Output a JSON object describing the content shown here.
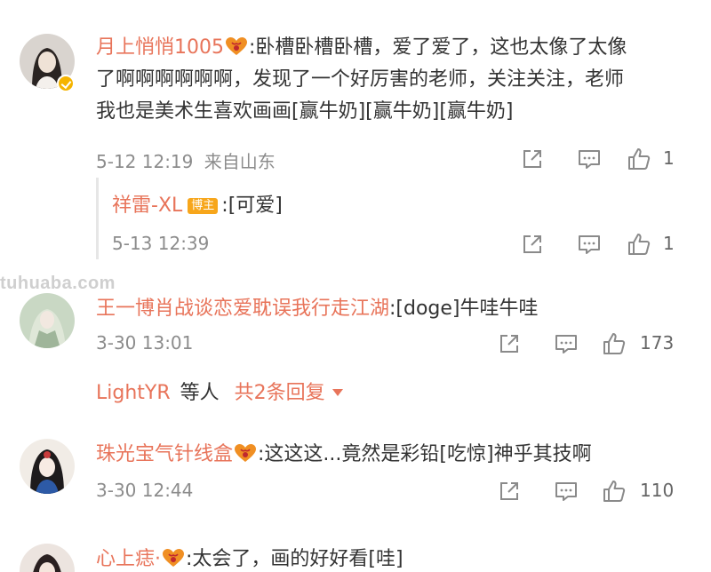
{
  "comments": [
    {
      "username": "月上悄悄1005",
      "text_line1": ":卧槽卧槽卧槽，爱了爱了，这也太像了太像",
      "text_line2": "了啊啊啊啊啊啊，发现了一个好厉害的老师，关注关注，老师",
      "text_line3": "我也是美术生喜欢画画[赢牛奶][赢牛奶][赢牛奶]",
      "time": "5-12 12:19",
      "location": "来自山东",
      "likes": "1"
    },
    {
      "username": "王一博肖战谈恋爱耽误我行走江湖",
      "text": ":[doge]牛哇牛哇",
      "time": "3-30 13:01",
      "likes": "173"
    },
    {
      "username": "珠光宝气针线盒",
      "text": ":这这这...竟然是彩铅[吃惊]神乎其技啊",
      "time": "3-30 12:44",
      "likes": "110"
    },
    {
      "username": "心上痣·",
      "text": ":太会了，画的好好看[哇]"
    }
  ],
  "reply": {
    "username": "祥雷-XL",
    "badge": "博主",
    "text": ":[可爱]",
    "time": "5-13 12:39",
    "likes": "1"
  },
  "more_replies": {
    "user": "LightYR",
    "middle": "等人",
    "link": "共2条回复"
  },
  "watermark": "tuhuaba.com",
  "colors": {
    "username": "#e8745a",
    "meta": "#8c8c8c",
    "badge": "#f7a61b"
  }
}
